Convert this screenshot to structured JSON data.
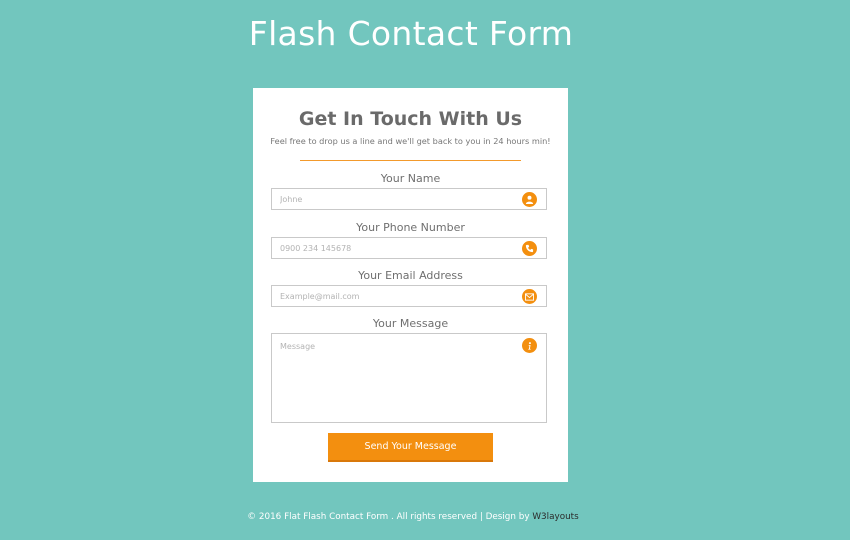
{
  "page": {
    "title": "Flash Contact Form"
  },
  "form": {
    "heading": "Get In Touch With Us",
    "subheading": "Feel free to drop us a line and we'll get back to you in 24 hours min!",
    "fields": [
      {
        "label": "Your Name",
        "placeholder": "Johne",
        "icon": "user-icon"
      },
      {
        "label": "Your Phone Number",
        "placeholder": "0900 234 145678",
        "icon": "phone-icon"
      },
      {
        "label": "Your Email Address",
        "placeholder": "Example@mail.com",
        "icon": "mail-icon"
      },
      {
        "label": "Your Message",
        "placeholder": "Message",
        "icon": "info-icon"
      }
    ],
    "submit_label": "Send Your Message"
  },
  "footer": {
    "text": "© 2016 Flat Flash Contact Form . All rights reserved | Design by ",
    "link": "W3layouts"
  },
  "colors": {
    "background": "#72c6be",
    "accent": "#f38f0f",
    "card": "#ffffff"
  }
}
